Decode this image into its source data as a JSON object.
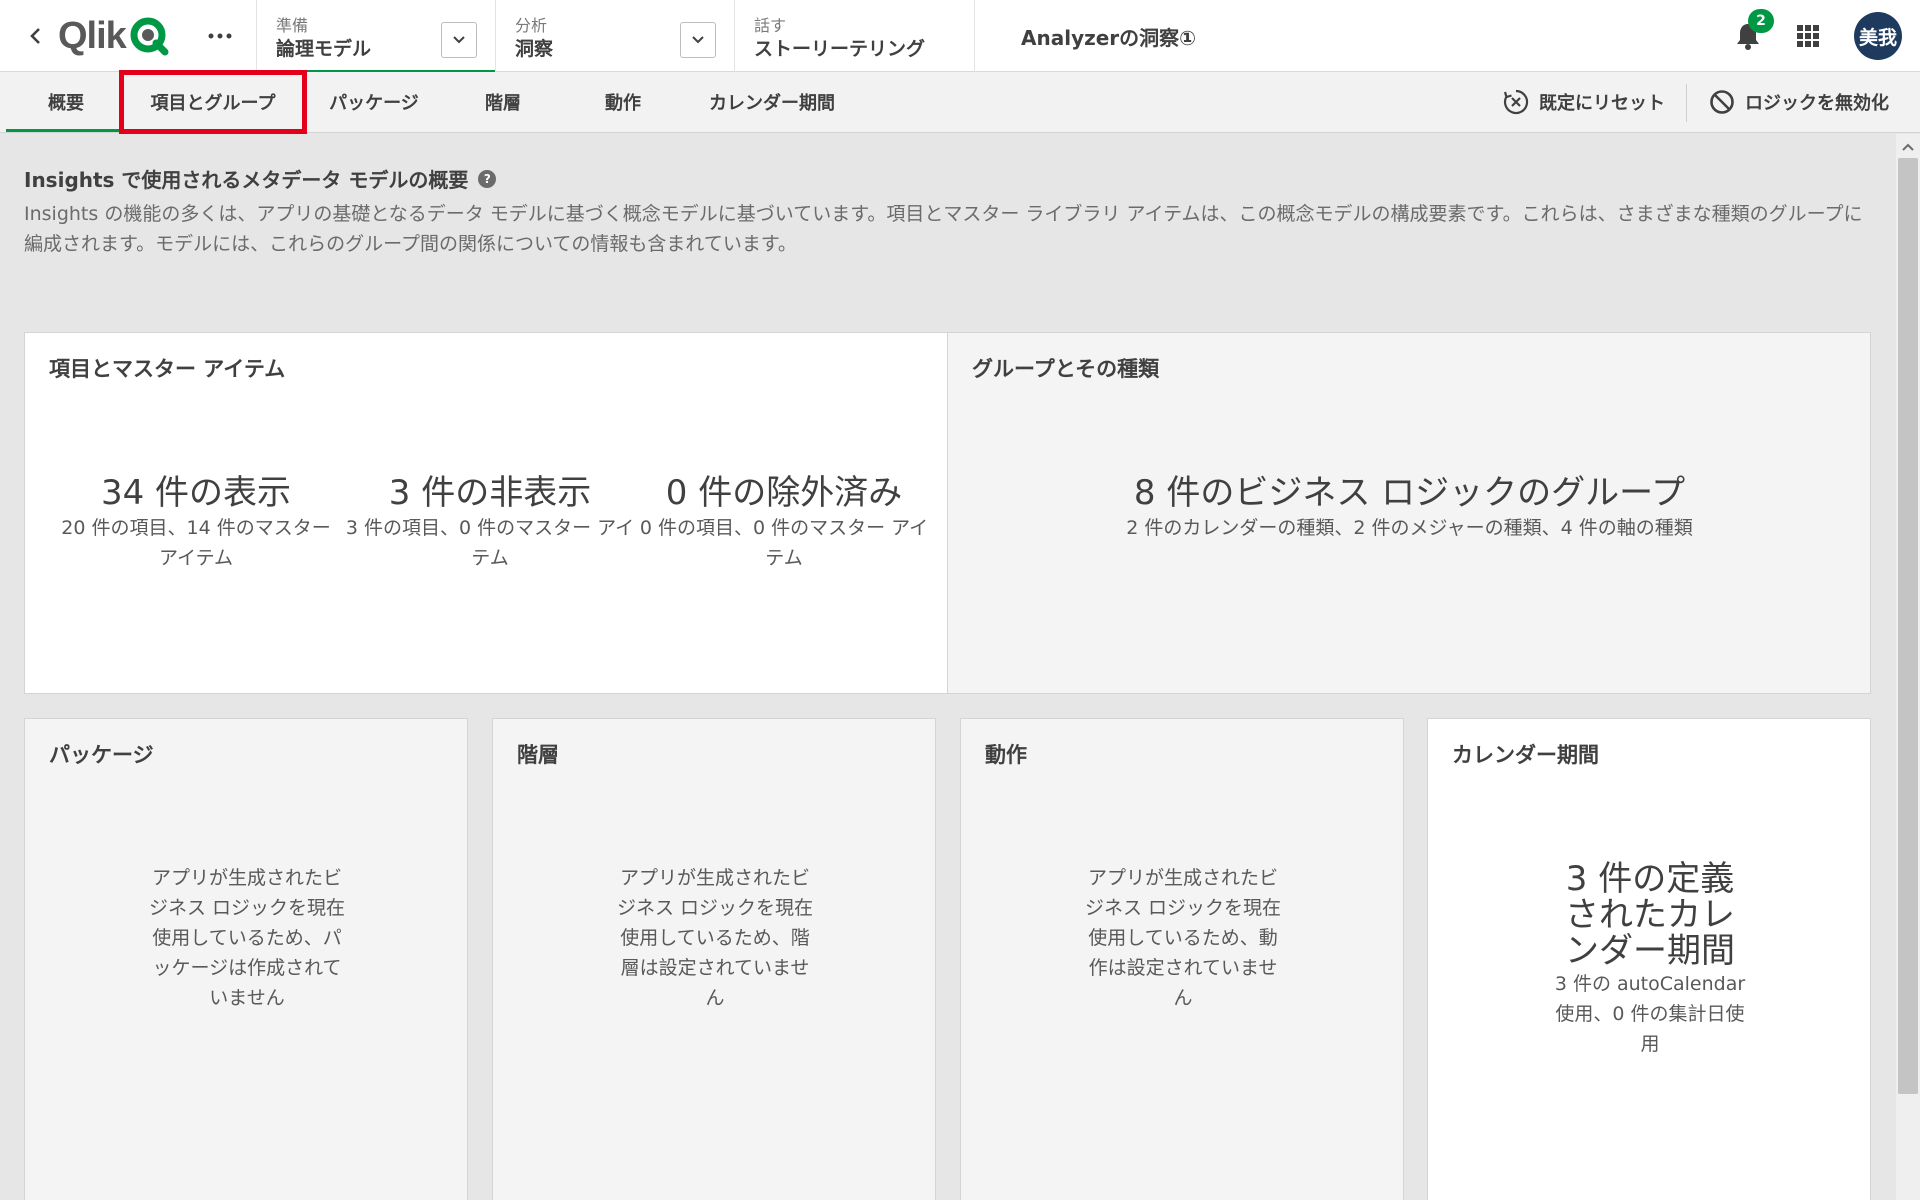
{
  "topbar": {
    "logo_text": "Qlik",
    "nav": [
      {
        "label": "準備",
        "value": "論理モデル"
      },
      {
        "label": "分析",
        "value": "洞察"
      },
      {
        "label": "話す",
        "value": "ストーリーテリング"
      }
    ],
    "app_title": "Analyzerの洞察①",
    "notification_count": "2",
    "avatar_initials": "美我"
  },
  "tabs": [
    {
      "label": "概要",
      "active": true
    },
    {
      "label": "項目とグループ",
      "highlighted": true
    },
    {
      "label": "パッケージ"
    },
    {
      "label": "階層"
    },
    {
      "label": "動作"
    },
    {
      "label": "カレンダー期間"
    }
  ],
  "actions": {
    "reset_label": "既定にリセット",
    "disable_logic_label": "ロジックを無効化"
  },
  "overview": {
    "heading": "Insights で使用されるメタデータ モデルの概要",
    "description": "Insights の機能の多くは、アプリの基礎となるデータ モデルに基づく概念モデルに基づいています。項目とマスター ライブラリ アイテムは、この概念モデルの構成要素です。これらは、さまざまな種類のグループに編成されます。モデルには、これらのグループ間の関係についての情報も含まれています。"
  },
  "cards": {
    "fields": {
      "title": "項目とマスター アイテム",
      "stats": [
        {
          "main": "34 件の表示",
          "sub": "20 件の項目、14 件のマスター アイテム"
        },
        {
          "main": "3 件の非表示",
          "sub": "3 件の項目、0 件のマスター アイテム"
        },
        {
          "main": "0 件の除外済み",
          "sub": "0 件の項目、0 件のマスター アイテム"
        }
      ]
    },
    "groups": {
      "title": "グループとその種類",
      "main": "8 件のビジネス ロジックのグループ",
      "sub": "2 件のカレンダーの種類、2 件のメジャーの種類、4 件の軸の種類"
    },
    "packages": {
      "title": "パッケージ",
      "message": "アプリが生成されたビジネス ロジックを現在使用しているため、パッケージは作成されていません"
    },
    "hierarchies": {
      "title": "階層",
      "message": "アプリが生成されたビジネス ロジックを現在使用しているため、階層は設定されていません"
    },
    "behaviors": {
      "title": "動作",
      "message": "アプリが生成されたビジネス ロジックを現在使用しているため、動作は設定されていません"
    },
    "calendar": {
      "title": "カレンダー期間",
      "main": "3 件の定義されたカレンダー期間",
      "sub": "3 件の autoCalendar 使用、0 件の集計日使用"
    }
  },
  "colors": {
    "accent_green": "#009845",
    "highlight_red": "#e3001b",
    "avatar_bg": "#1f3a5f"
  },
  "icons": [
    "chevron-left-icon",
    "qlik-logo-icon",
    "more-icon",
    "chevron-down-icon",
    "bell-icon",
    "apps-grid-icon",
    "reset-icon",
    "disable-icon",
    "help-icon",
    "scroll-up-icon"
  ]
}
